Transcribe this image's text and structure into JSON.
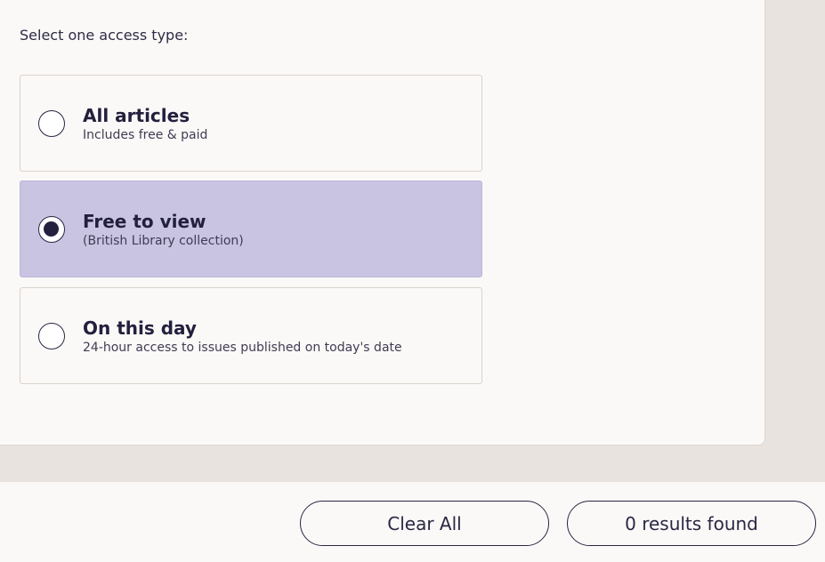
{
  "access": {
    "prompt": "Select one access type:",
    "options": [
      {
        "title": "All articles",
        "subtitle": "Includes free & paid",
        "selected": false
      },
      {
        "title": "Free to view",
        "subtitle": "(British Library collection)",
        "selected": true
      },
      {
        "title": "On this day",
        "subtitle": "24-hour access to issues published on today's date",
        "selected": false
      }
    ]
  },
  "footer": {
    "clear_label": "Clear All",
    "results_label": "0 results found"
  },
  "colors": {
    "selected_bg": "#c8c4e2",
    "ink": "#24213f",
    "page_bg": "#e8e3de",
    "panel_bg": "#fbf9f7"
  }
}
